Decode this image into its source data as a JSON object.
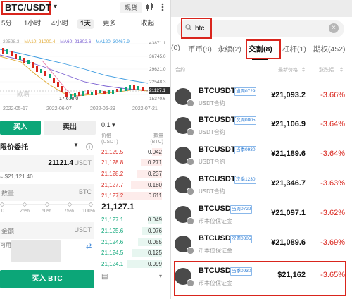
{
  "left": {
    "pair": "BTC/USDT",
    "spot_tag": "现货",
    "timeframes": [
      "5分",
      "1小时",
      "4小时",
      "1天",
      "更多",
      "收起"
    ],
    "legend": [
      {
        "text": "22598.3",
        "color": "#9e9e9e"
      },
      {
        "text": "MA10: 21000.4",
        "color": "#e0a82e"
      },
      {
        "text": "MA60: 21802.6",
        "color": "#7a5fd1"
      },
      {
        "text": "MA120: 30467.9",
        "color": "#3c9be0"
      }
    ],
    "price_scale": [
      "43871.1",
      "36745.0",
      "29621.0",
      "22548.3",
      "21127.1",
      "15370.6"
    ],
    "chart_low": "17,618.0",
    "watermark": "欧易",
    "dates": [
      "2022-05-17",
      "2022-06-07",
      "2022-06-29",
      "2022-07-21"
    ],
    "buy_tab": "买入",
    "sell_tab": "卖出",
    "order_type": "限价委托",
    "price_input": {
      "value": "21121.4",
      "unit": "USDT"
    },
    "approx": "≈ $21,121.40",
    "qty_input": {
      "label": "数量",
      "unit": "BTC"
    },
    "slider_marks": [
      "0",
      "25%",
      "50%",
      "75%",
      "100%"
    ],
    "amount_input": {
      "label": "金额",
      "unit": "USDT"
    },
    "avail_label": "可用",
    "buy_button": "买入 BTC"
  },
  "orderbook": {
    "precision": "0.1",
    "headers": {
      "price_label": "价格",
      "price_unit": "(USDT)",
      "qty_label": "数量",
      "qty_unit": "(BTC)"
    },
    "asks": [
      {
        "price": "21,129.5",
        "qty": "0.042"
      },
      {
        "price": "21,128.8",
        "qty": "0.271"
      },
      {
        "price": "21,128.2",
        "qty": "0.237"
      },
      {
        "price": "21,127.7",
        "qty": "0.180"
      },
      {
        "price": "21,127.2",
        "qty": "0.611"
      }
    ],
    "mid_price": "21,127.1",
    "mid_sub": "≈ $21,127.1",
    "bids": [
      {
        "price": "21,127.1",
        "qty": "0.049"
      },
      {
        "price": "21,125.6",
        "qty": "0.076"
      },
      {
        "price": "21,124.6",
        "qty": "0.055"
      },
      {
        "price": "21,124.5",
        "qty": "0.125"
      },
      {
        "price": "21,124.1",
        "qty": "0.099"
      }
    ]
  },
  "right": {
    "search_value": "btc",
    "categories": [
      {
        "label": "(0)"
      },
      {
        "label": "币币(8)"
      },
      {
        "label": "永续(2)"
      },
      {
        "label": "交割(8)",
        "active": true
      },
      {
        "label": "杠杆(1)"
      },
      {
        "label": "期权(452)"
      }
    ],
    "col_heads": {
      "name": "合约",
      "price": "最新价格",
      "change": "涨跌幅"
    },
    "items": [
      {
        "symbol": "BTCUSDT",
        "tag": "当周0729",
        "sub": "USDT合约",
        "price": "¥21,093.2",
        "change": "-3.66%"
      },
      {
        "symbol": "BTCUSDT",
        "tag": "次周0805",
        "sub": "USDT合约",
        "price": "¥21,106.9",
        "change": "-3.64%"
      },
      {
        "symbol": "BTCUSDT",
        "tag": "当季0930",
        "sub": "USDT合约",
        "price": "¥21,189.6",
        "change": "-3.64%"
      },
      {
        "symbol": "BTCUSDT",
        "tag": "次季1230",
        "sub": "USDT合约",
        "price": "¥21,346.7",
        "change": "-3.63%"
      },
      {
        "symbol": "BTCUSD",
        "tag": "当周0729",
        "sub": "币本位保证金",
        "price": "¥21,097.1",
        "change": "-3.62%"
      },
      {
        "symbol": "BTCUSD",
        "tag": "次周0805",
        "sub": "币本位保证金",
        "price": "¥21,089.6",
        "change": "-3.69%"
      },
      {
        "symbol": "BTCUSD",
        "tag": "当季0930",
        "sub": "币本位保证金",
        "price": "$21,162",
        "change": "-3.65%"
      }
    ]
  }
}
